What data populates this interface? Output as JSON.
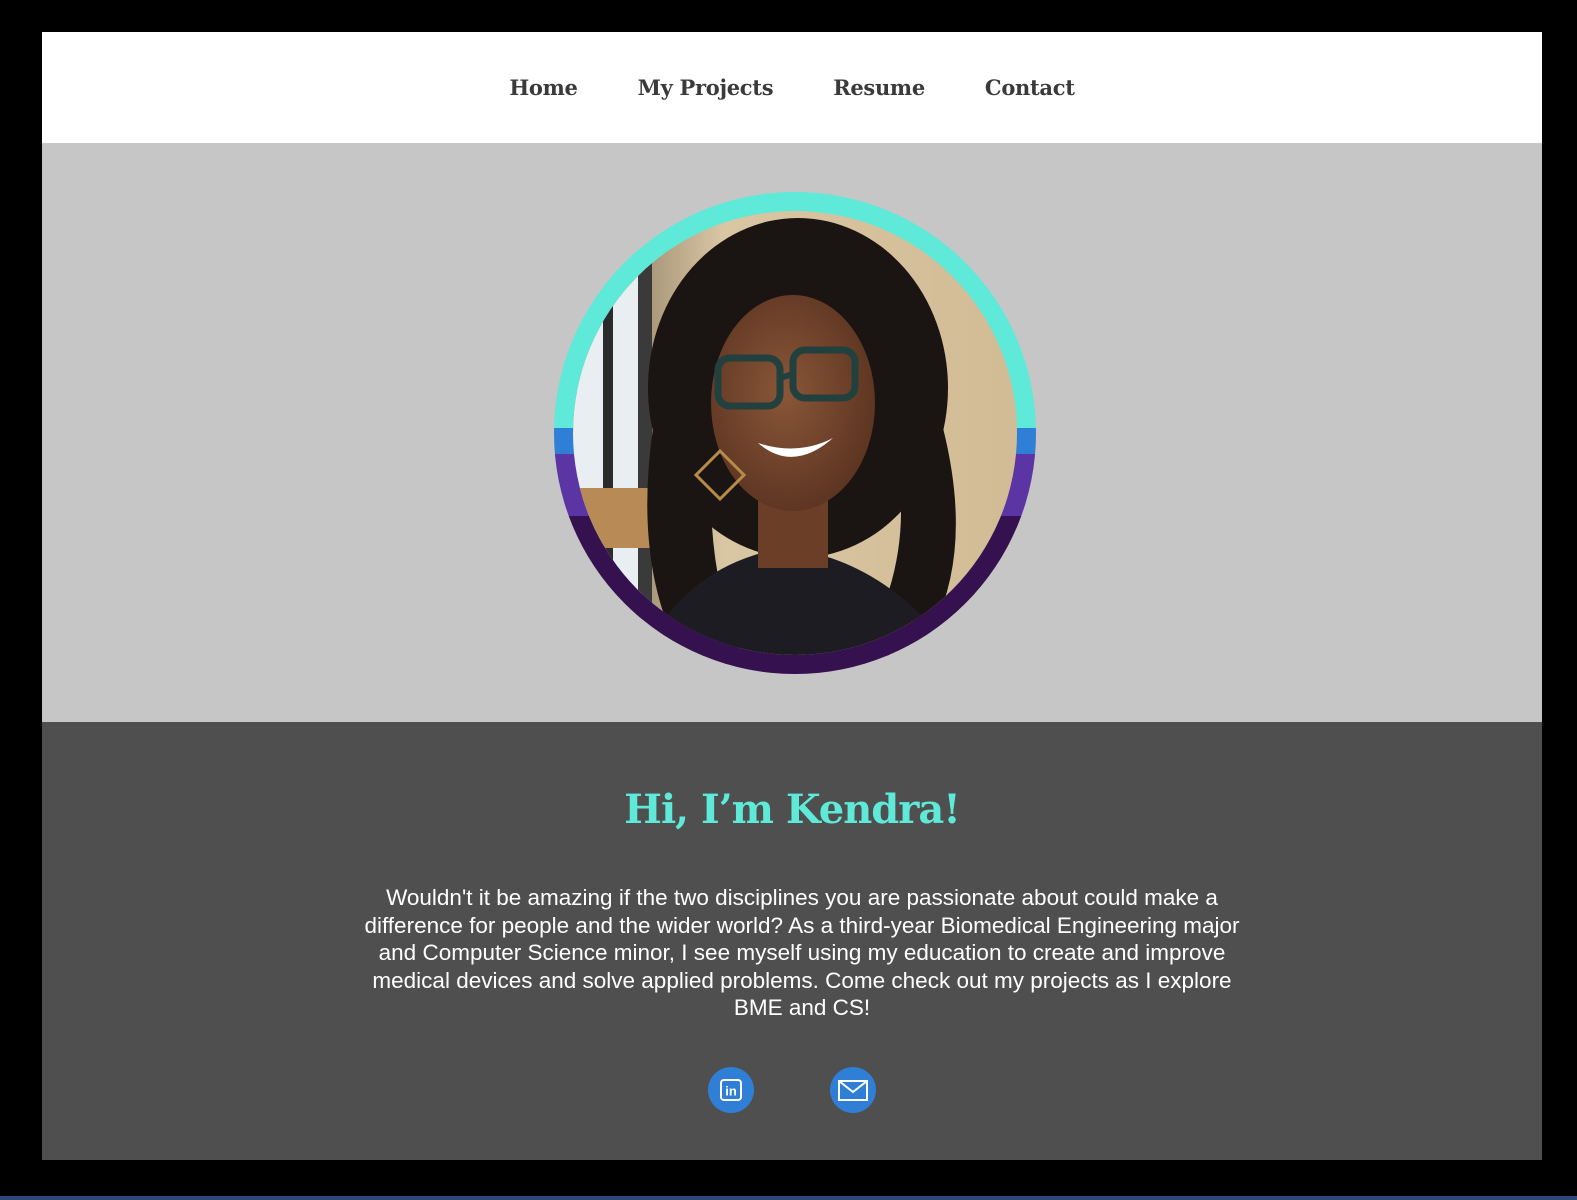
{
  "nav": {
    "items": [
      {
        "label": "Home"
      },
      {
        "label": "My Projects"
      },
      {
        "label": "Resume"
      },
      {
        "label": "Contact"
      }
    ]
  },
  "hero": {
    "photo_alt": "Portrait photo of Kendra",
    "ring_colors": {
      "top": "#5ee9d8",
      "middle": "#2f7fd6",
      "lower": "#5b35a3",
      "bottom": "#35124f"
    }
  },
  "about": {
    "greeting": "Hi, I’m Kendra!",
    "bio": "Wouldn't it be amazing if the two disciplines you are passionate about could make a difference for people and the wider world? As a third-year Biomedical Engineering major and Computer Science minor, I see myself using my education to create and improve medical devices and solve applied problems. Come check out my projects as I explore BME and CS!",
    "social": [
      {
        "icon": "linkedin-icon",
        "label": "in"
      },
      {
        "icon": "envelope-icon"
      }
    ]
  },
  "colors": {
    "accent": "#5ee9d8",
    "nav_bg": "#ffffff",
    "hero_bg": "#c6c6c6",
    "about_bg": "#4f4f4f",
    "social_blue": "#2f7fd6"
  }
}
